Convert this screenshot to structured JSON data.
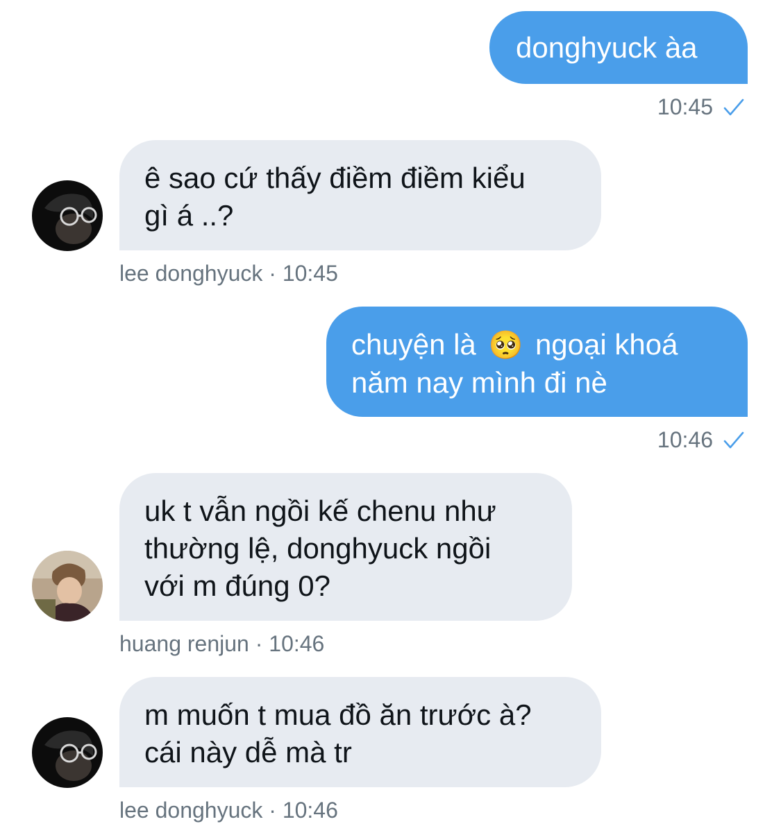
{
  "messages": [
    {
      "direction": "out",
      "text": "donghyuck àa",
      "time": "10:45"
    },
    {
      "direction": "in",
      "text": "ê sao cứ thấy điềm điềm kiểu\ngì á ..?",
      "sender": "lee donghyuck",
      "sender_time": "lee donghyuck · 10:45"
    },
    {
      "direction": "out",
      "text_before": "chuyện là",
      "emoji": "🥺",
      "text_after": "ngoại khoá\nnăm nay mình đi nè",
      "time": "10:46"
    },
    {
      "direction": "in",
      "text": "uk t vẫn ngồi kế chenu như\nthường lệ, donghyuck ngồi\nvới m đúng 0?",
      "sender": "huang renjun",
      "sender_time": "huang renjun · 10:46"
    },
    {
      "direction": "in",
      "text": "m muốn t mua đồ ăn trước à?\ncái này dễ mà tr",
      "sender": "lee donghyuck",
      "sender_time": "lee donghyuck · 10:46"
    }
  ],
  "colors": {
    "outgoing_bubble": "#4a9eea",
    "incoming_bubble": "#e7ebf1",
    "meta_text": "#66737e",
    "read_check": "#4a9eea"
  },
  "icons": {
    "read_receipt": "check-icon"
  }
}
